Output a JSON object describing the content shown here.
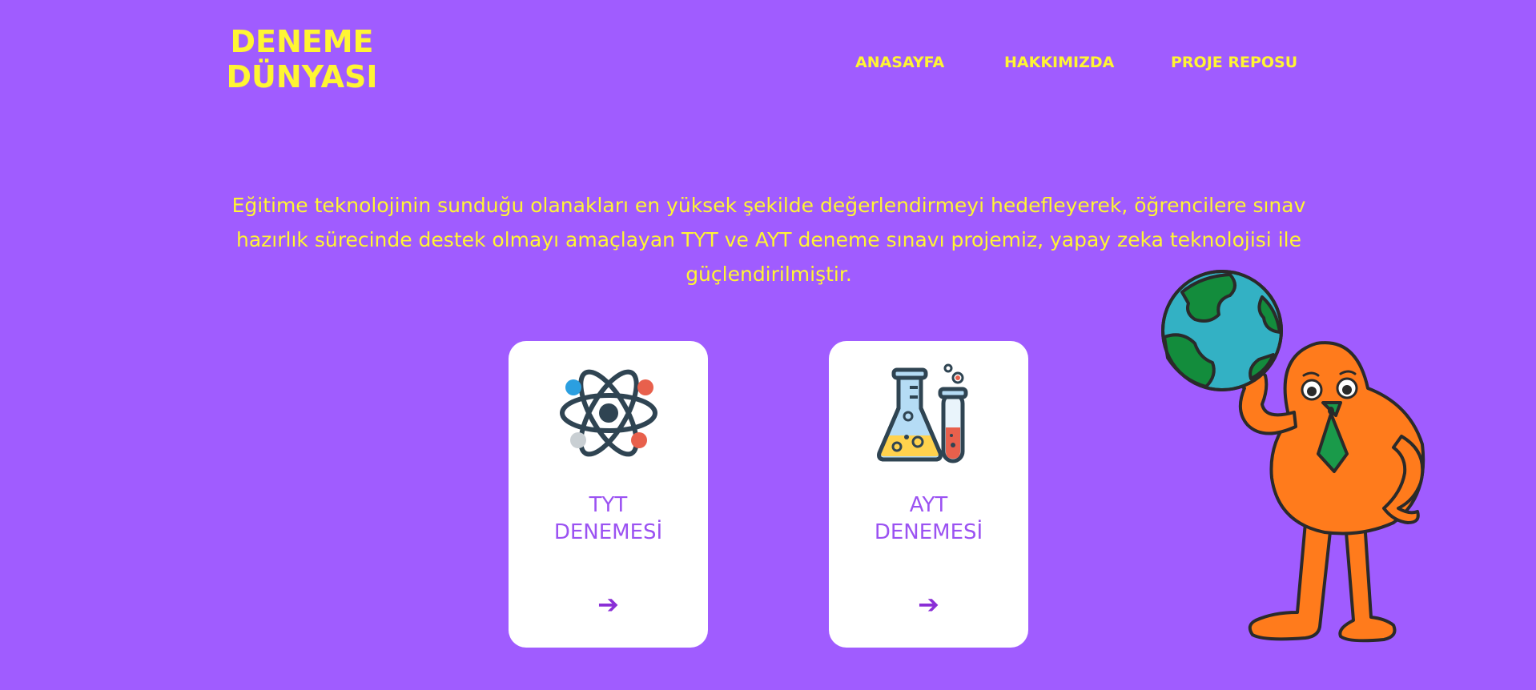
{
  "header": {
    "logo_line1": "DENEME",
    "logo_line2": "DÜNYASI",
    "nav": [
      {
        "label": "ANASAYFA"
      },
      {
        "label": "HAKKIMIZDA"
      },
      {
        "label": "PROJE REPOSU"
      }
    ]
  },
  "intro": {
    "text": "Eğitime teknolojinin sunduğu olanakları en yüksek şekilde değerlendirmeyi hedefleyerek, öğrencilere sınav hazırlık sürecinde destek olmayı amaçlayan TYT ve AYT deneme sınavı projemiz, yapay zeka teknolojisi ile güçlendirilmiştir."
  },
  "cards": [
    {
      "line1": "TYT",
      "line2": "DENEMESİ",
      "icon": "atom-icon",
      "arrow": "➔"
    },
    {
      "line1": "AYT",
      "line2": "DENEMESİ",
      "icon": "chemistry-flask-icon",
      "arrow": "➔"
    }
  ],
  "colors": {
    "background": "#a05cff",
    "accent_yellow": "#fff533",
    "card_text": "#9b52f2",
    "arrow": "#8a2fd6",
    "character_orange": "#ff7b1c"
  },
  "illustration": "globe-character-illustration"
}
